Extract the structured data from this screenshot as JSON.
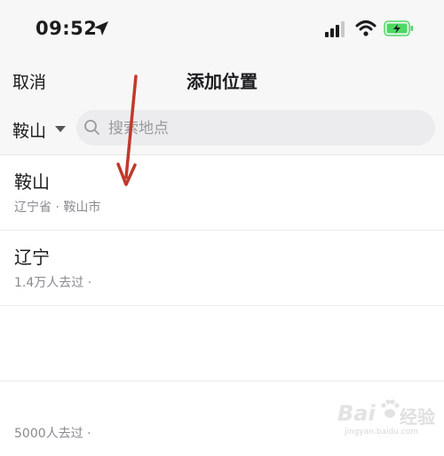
{
  "status_bar": {
    "time": "09:52",
    "icons": [
      "location-arrow-icon",
      "cellular-signal-icon",
      "wifi-icon",
      "battery-charging-icon"
    ],
    "battery_color": "#4cd964"
  },
  "nav": {
    "cancel_label": "取消",
    "title": "添加位置"
  },
  "search": {
    "city": "鞍山",
    "placeholder": "搜索地点"
  },
  "results": [
    {
      "title": "鞍山",
      "subtitle": "辽宁省 · 鞍山市"
    },
    {
      "title": "辽宁",
      "subtitle": "1.4万人去过 ·"
    },
    {
      "title": "",
      "subtitle": ""
    },
    {
      "title": "",
      "subtitle": "5000人去过 ·"
    }
  ],
  "annotation": {
    "arrow_color": "#c0392b"
  },
  "watermark": {
    "brand": "Bai",
    "product": "经验",
    "url": "jingyan.baidu.com"
  }
}
